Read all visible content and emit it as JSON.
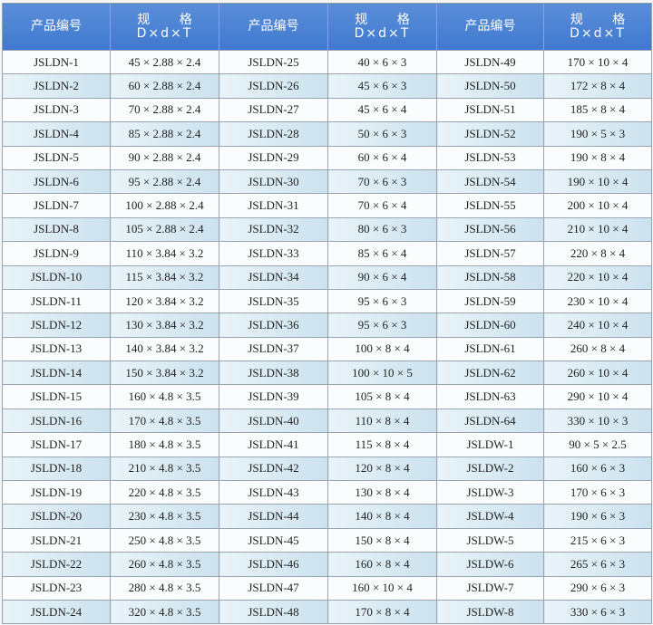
{
  "headers": {
    "code": "产品编号",
    "spec_line1": "规 格",
    "spec_line2": "D×d×T"
  },
  "rows": [
    [
      [
        "JSLDN-1",
        "45 × 2.88 × 2.4"
      ],
      [
        "JSLDN-25",
        "40 × 6 × 3"
      ],
      [
        "JSLDN-49",
        "170 × 10 × 4"
      ]
    ],
    [
      [
        "JSLDN-2",
        "60 × 2.88 × 2.4"
      ],
      [
        "JSLDN-26",
        "45 × 6 × 3"
      ],
      [
        "JSLDN-50",
        "172 × 8 × 4"
      ]
    ],
    [
      [
        "JSLDN-3",
        "70 × 2.88 × 2.4"
      ],
      [
        "JSLDN-27",
        "45 × 6 × 4"
      ],
      [
        "JSLDN-51",
        "185 × 8 × 4"
      ]
    ],
    [
      [
        "JSLDN-4",
        "85 × 2.88 × 2.4"
      ],
      [
        "JSLDN-28",
        "50 × 6 × 3"
      ],
      [
        "JSLDN-52",
        "190 × 5 × 3"
      ]
    ],
    [
      [
        "JSLDN-5",
        "90 × 2.88 × 2.4"
      ],
      [
        "JSLDN-29",
        "60 × 6 × 4"
      ],
      [
        "JSLDN-53",
        "190 × 8 × 4"
      ]
    ],
    [
      [
        "JSLDN-6",
        "95 × 2.88 × 2.4"
      ],
      [
        "JSLDN-30",
        "70 × 6 × 3"
      ],
      [
        "JSLDN-54",
        "190 × 10 × 4"
      ]
    ],
    [
      [
        "JSLDN-7",
        "100 × 2.88 × 2.4"
      ],
      [
        "JSLDN-31",
        "70 × 6 × 4"
      ],
      [
        "JSLDN-55",
        "200 × 10 × 4"
      ]
    ],
    [
      [
        "JSLDN-8",
        "105 × 2.88 × 2.4"
      ],
      [
        "JSLDN-32",
        "80 × 6 × 3"
      ],
      [
        "JSLDN-56",
        "210 × 10 × 4"
      ]
    ],
    [
      [
        "JSLDN-9",
        "110 × 3.84 × 3.2"
      ],
      [
        "JSLDN-33",
        "85 × 6 × 4"
      ],
      [
        "JSLDN-57",
        "220 × 8 × 4"
      ]
    ],
    [
      [
        "JSLDN-10",
        "115 × 3.84 × 3.2"
      ],
      [
        "JSLDN-34",
        "90 × 6 × 4"
      ],
      [
        "JSLDN-58",
        "220 × 10 × 4"
      ]
    ],
    [
      [
        "JSLDN-11",
        "120 × 3.84 × 3.2"
      ],
      [
        "JSLDN-35",
        "95 × 6 × 3"
      ],
      [
        "JSLDN-59",
        "230 × 10 × 4"
      ]
    ],
    [
      [
        "JSLDN-12",
        "130 × 3.84 × 3.2"
      ],
      [
        "JSLDN-36",
        "95 × 6 × 3"
      ],
      [
        "JSLDN-60",
        "240 × 10 × 4"
      ]
    ],
    [
      [
        "JSLDN-13",
        "140 × 3.84 × 3.2"
      ],
      [
        "JSLDN-37",
        "100 × 8 × 4"
      ],
      [
        "JSLDN-61",
        "260 × 8 × 4"
      ]
    ],
    [
      [
        "JSLDN-14",
        "150 × 3.84 × 3.2"
      ],
      [
        "JSLDN-38",
        "100 × 10 × 5"
      ],
      [
        "JSLDN-62",
        "260 × 10 × 4"
      ]
    ],
    [
      [
        "JSLDN-15",
        "160 × 4.8 × 3.5"
      ],
      [
        "JSLDN-39",
        "105 × 8 × 4"
      ],
      [
        "JSLDN-63",
        "290 × 10 × 4"
      ]
    ],
    [
      [
        "JSLDN-16",
        "170 × 4.8 × 3.5"
      ],
      [
        "JSLDN-40",
        "110 × 8 × 4"
      ],
      [
        "JSLDN-64",
        "330 × 10 × 3"
      ]
    ],
    [
      [
        "JSLDN-17",
        "180 × 4.8 × 3.5"
      ],
      [
        "JSLDN-41",
        "115 × 8 × 4"
      ],
      [
        "JSLDW-1",
        "90 × 5 × 2.5"
      ]
    ],
    [
      [
        "JSLDN-18",
        "210 × 4.8 × 3.5"
      ],
      [
        "JSLDN-42",
        "120 × 8 × 4"
      ],
      [
        "JSLDW-2",
        "160 × 6 × 3"
      ]
    ],
    [
      [
        "JSLDN-19",
        "220 × 4.8 × 3.5"
      ],
      [
        "JSLDN-43",
        "130 × 8 × 4"
      ],
      [
        "JSLDW-3",
        "170 × 6 × 3"
      ]
    ],
    [
      [
        "JSLDN-20",
        "230 × 4.8 × 3.5"
      ],
      [
        "JSLDN-44",
        "140 × 8 × 4"
      ],
      [
        "JSLDW-4",
        "190 × 6 × 3"
      ]
    ],
    [
      [
        "JSLDN-21",
        "250 × 4.8 × 3.5"
      ],
      [
        "JSLDN-45",
        "150 × 8 × 4"
      ],
      [
        "JSLDW-5",
        "215 × 6 × 3"
      ]
    ],
    [
      [
        "JSLDN-22",
        "260 × 4.8 × 3.5"
      ],
      [
        "JSLDN-46",
        "160 × 8 × 4"
      ],
      [
        "JSLDW-6",
        "265 × 6 × 3"
      ]
    ],
    [
      [
        "JSLDN-23",
        "280 × 4.8 × 3.5"
      ],
      [
        "JSLDN-47",
        "160 × 10 × 4"
      ],
      [
        "JSLDW-7",
        "290 × 6 × 3"
      ]
    ],
    [
      [
        "JSLDN-24",
        "320 × 4.8 × 3.5"
      ],
      [
        "JSLDN-48",
        "170 × 8 × 4"
      ],
      [
        "JSLDW-8",
        "330 × 6 × 3"
      ]
    ]
  ]
}
